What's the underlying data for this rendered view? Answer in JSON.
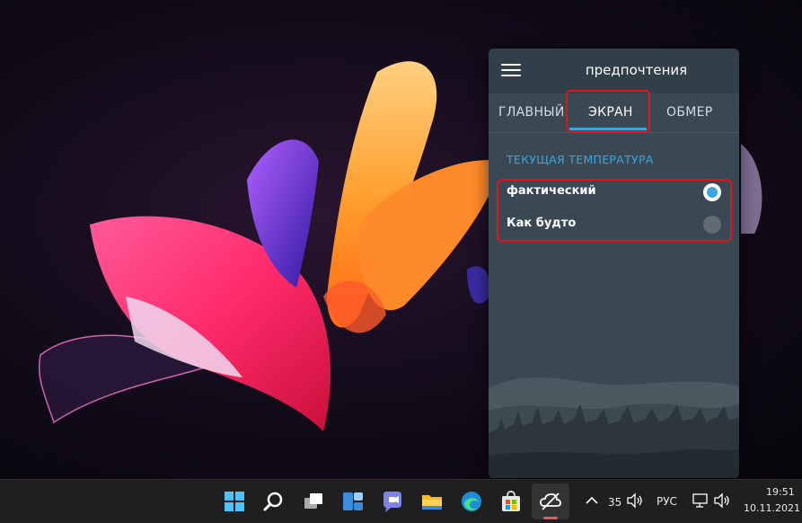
{
  "panel": {
    "title": "предпочтения",
    "tabs": [
      {
        "label": "ГЛАВНЫЙ"
      },
      {
        "label": "ЭКРАН"
      },
      {
        "label": "ОБМЕР"
      }
    ],
    "active_tab": "ЭКРАН",
    "section_title": "ТЕКУЩАЯ ТЕМПЕРАТУРА",
    "options": [
      {
        "label": "фактический",
        "selected": true
      },
      {
        "label": "Как будто",
        "selected": false
      }
    ],
    "accent_color": "#39a8e0",
    "highlight_color": "#e0151b"
  },
  "taskbar": {
    "icons": [
      "windows-start-icon",
      "search-icon",
      "task-view-icon",
      "widgets-icon",
      "chat-icon",
      "file-explorer-icon",
      "edge-icon",
      "store-icon",
      "weather-app-icon"
    ],
    "tray": {
      "temperature": "35",
      "language": "РУС",
      "time": "19:51",
      "date": "10.11.2021"
    }
  }
}
